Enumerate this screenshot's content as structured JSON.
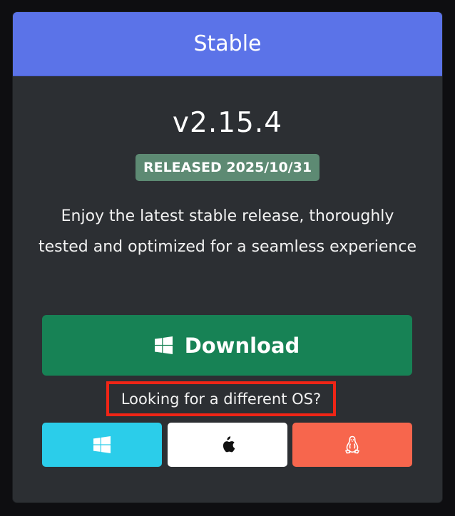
{
  "card": {
    "header_title": "Stable",
    "version": "v2.15.4",
    "badge": "RELEASED 2025/10/31",
    "description": "Enjoy the latest stable release, thoroughly tested and optimized for a seamless experience",
    "download": {
      "label": "Download",
      "icon": "windows-icon"
    },
    "different_os_link": "Looking for a different OS?",
    "os_buttons": [
      {
        "icon": "windows-icon",
        "color": "#2bcdea"
      },
      {
        "icon": "apple-icon",
        "color": "#ffffff"
      },
      {
        "icon": "linux-icon",
        "color": "#f7664d"
      }
    ]
  },
  "colors": {
    "page_background": "#0e0e11",
    "card_background": "#2c2f33",
    "header_background": "#5b73e8",
    "badge_background": "#5d8a73",
    "download_button": "#178255",
    "highlight_border": "#f02516"
  }
}
